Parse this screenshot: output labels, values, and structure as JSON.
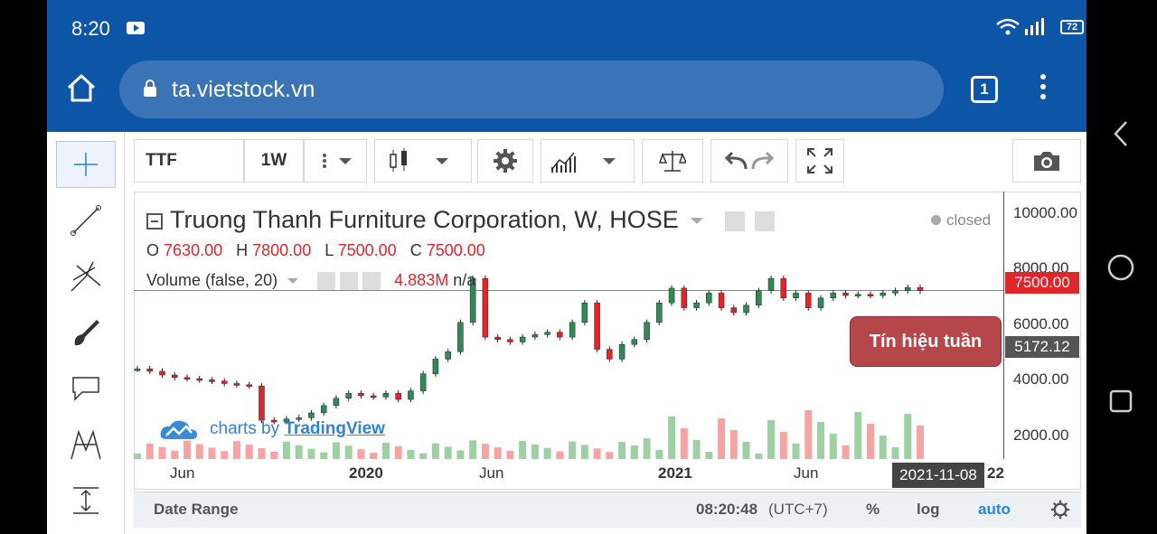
{
  "status": {
    "time": "8:20",
    "battery": "72"
  },
  "browser": {
    "url": "ta.vietstock.vn",
    "tab_count": "1"
  },
  "toolbar": {
    "symbol": "TTF",
    "interval": "1W"
  },
  "chart_header": {
    "title": "Truong Thanh Furniture Corporation, W, HOSE",
    "open_label": "O",
    "open": "7630.00",
    "high_label": "H",
    "high": "7800.00",
    "low_label": "L",
    "low": "7500.00",
    "close_label": "C",
    "close": "7500.00",
    "volume_label": "Volume (false, 20)",
    "volume_value": "4.883M",
    "volume_na": "n/a",
    "market_status": "closed"
  },
  "axis": {
    "y_ticks": [
      "10000.00",
      "8000.00",
      "6000.00",
      "4000.00",
      "2000.00"
    ],
    "last_price": "7500.00",
    "crosshair_price": "5172.12",
    "x_ticks": [
      "Jun",
      "2020",
      "Jun",
      "2021",
      "Jun",
      "22"
    ],
    "crosshair_date": "2021-11-08"
  },
  "annotation": {
    "signal_text": "Tín hiệu tuần"
  },
  "branding": {
    "prefix": "charts by",
    "brand": "TradingView"
  },
  "bottom_bar": {
    "date_range": "Date Range",
    "time": "08:20:48",
    "timezone": "(UTC+7)",
    "percent": "%",
    "log": "log",
    "auto": "auto"
  },
  "colors": {
    "up": "#2e8b57",
    "down": "#e0262b",
    "accent": "#0d55a7"
  },
  "chart_data": {
    "type": "candlestick",
    "series": [
      {
        "name": "price",
        "values": [
          4300,
          4200,
          4050,
          3950,
          3900,
          3850,
          3800,
          3700,
          3650,
          3600,
          2200,
          2150,
          2250,
          2300,
          2500,
          2800,
          3100,
          3300,
          3200,
          3150,
          3300,
          3050,
          3400,
          4100,
          4700,
          5000,
          6200,
          8000,
          5600,
          5500,
          5400,
          5600,
          5700,
          5800,
          5600,
          6200,
          7000,
          5100,
          4700,
          5300,
          5500,
          6200,
          7000,
          7600,
          6800,
          7000,
          7400,
          6800,
          6600,
          6900,
          7500,
          8000,
          7200,
          7400,
          6800,
          7200,
          7400,
          7300,
          7350,
          7300,
          7400,
          7500,
          7630,
          7500
        ]
      }
    ]
  }
}
